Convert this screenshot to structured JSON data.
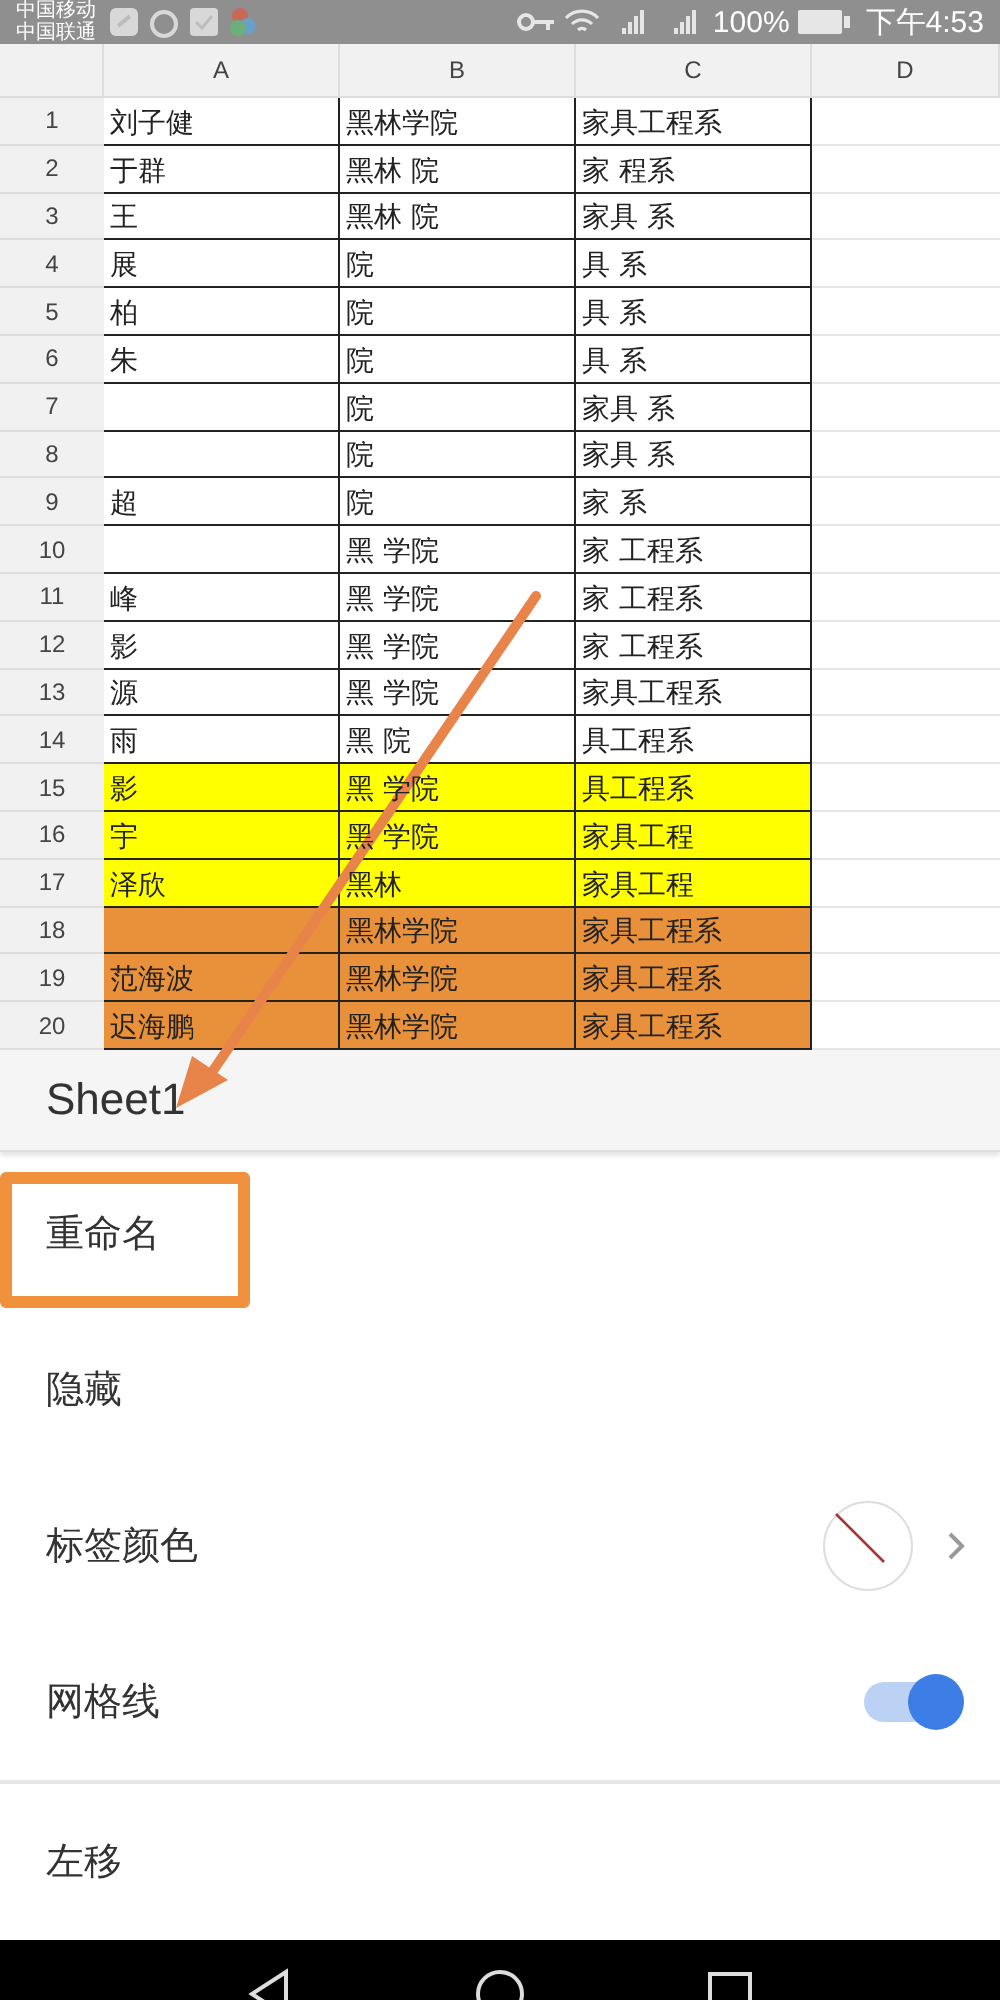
{
  "status_bar": {
    "carriers": [
      "中国移动",
      "中国联通"
    ],
    "battery": "100%",
    "time": "下午4:53"
  },
  "sheet": {
    "columns": [
      "A",
      "B",
      "C",
      "D"
    ],
    "rows": [
      {
        "number": "1",
        "cells": [
          "刘子健",
          "黑林学院",
          "家具工程系"
        ]
      },
      {
        "number": "2",
        "cells": [
          "于群",
          "黑林 院",
          "家 程系"
        ]
      },
      {
        "number": "3",
        "cells": [
          "王",
          "黑林 院",
          "家具 系"
        ]
      },
      {
        "number": "4",
        "cells": [
          "展",
          "院",
          "具 系"
        ]
      },
      {
        "number": "5",
        "cells": [
          "柏",
          "院",
          "具 系"
        ]
      },
      {
        "number": "6",
        "cells": [
          "朱",
          "院",
          "具 系"
        ]
      },
      {
        "number": "7",
        "cells": [
          null,
          "院",
          "家具 系"
        ]
      },
      {
        "number": "8",
        "cells": [
          null,
          "院",
          "家具 系"
        ]
      },
      {
        "number": "9",
        "cells": [
          "超",
          "院",
          "家 系"
        ]
      },
      {
        "number": "10",
        "cells": [
          null,
          "黑 学院",
          "家 工程系"
        ]
      },
      {
        "number": "11",
        "cells": [
          "峰",
          "黑 学院",
          "家 工程系"
        ]
      },
      {
        "number": "12",
        "cells": [
          "影",
          "黑 学院",
          "家 工程系"
        ]
      },
      {
        "number": "13",
        "cells": [
          "源",
          "黑 学院",
          "家具工程系"
        ]
      },
      {
        "number": "14",
        "cells": [
          "雨",
          "黑 院",
          "具工程系"
        ]
      },
      {
        "number": "15",
        "cells": [
          "影",
          "黑 学院",
          "具工程系"
        ],
        "color": "#ffff00"
      },
      {
        "number": "16",
        "cells": [
          "宇",
          "黑 学院",
          "家具工程"
        ],
        "color": "#ffff00"
      },
      {
        "number": "17",
        "cells": [
          "泽欣",
          "黑林",
          "家具工程"
        ],
        "color": "#ffff00"
      },
      {
        "number": "18",
        "cells": [
          null,
          "黑林学院",
          "家具工程系"
        ],
        "color": "#e8913a"
      },
      {
        "number": "19",
        "cells": [
          "范海波",
          "黑林学院",
          "家具工程系"
        ],
        "color": "#e8913a"
      },
      {
        "number": "20",
        "cells": [
          "迟海鹏",
          "黑林学院",
          "家具工程系"
        ],
        "color": "#e8913a"
      }
    ]
  },
  "menu": {
    "title": "Sheet1",
    "items": [
      {
        "kind": "plain",
        "label": "重命名",
        "highlighted": true
      },
      {
        "kind": "plain",
        "label": "隐藏",
        "highlighted": false
      },
      {
        "kind": "color",
        "label": "标签颜色",
        "highlighted": false
      },
      {
        "kind": "toggle",
        "label": "网格线",
        "on": true,
        "highlighted": false
      },
      {
        "kind": "plain",
        "label": "左移",
        "highlighted": false
      }
    ]
  }
}
